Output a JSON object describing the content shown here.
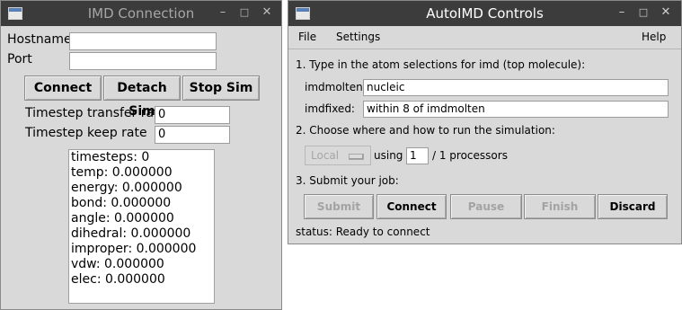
{
  "left": {
    "title": "IMD Connection",
    "hostname_label": "Hostname",
    "hostname_value": "",
    "port_label": "Port",
    "port_value": "",
    "connect": "Connect",
    "detach": "Detach Sim",
    "stop": "Stop Sim",
    "transfer_label": "Timestep transfer rate",
    "transfer_value": "0",
    "keep_label": "Timestep keep rate",
    "keep_value": "0",
    "stats": [
      "timesteps: 0",
      "temp: 0.000000",
      "energy: 0.000000",
      "bond: 0.000000",
      "angle: 0.000000",
      "dihedral: 0.000000",
      "improper: 0.000000",
      "vdw: 0.000000",
      "elec: 0.000000"
    ]
  },
  "right": {
    "title": "AutoIMD Controls",
    "menu_file": "File",
    "menu_settings": "Settings",
    "menu_help": "Help",
    "step1": "1. Type in the atom selections for imd (top molecule):",
    "molten_label": "imdmolten:",
    "molten_value": "nucleic",
    "fixed_label": "imdfixed:",
    "fixed_value": "within 8 of imdmolten",
    "step2": "2. Choose where and how to run the simulation:",
    "location": "Local",
    "using_label": "using",
    "processors_value": "1",
    "processors_suffix": "/ 1 processors",
    "step3": "3. Submit your job:",
    "submit": "Submit",
    "connect": "Connect",
    "pause": "Pause",
    "finish": "Finish",
    "discard": "Discard",
    "status": "status: Ready to connect"
  },
  "titlebar_icons": [
    "minimize-icon",
    "maximize-icon",
    "close-icon"
  ]
}
